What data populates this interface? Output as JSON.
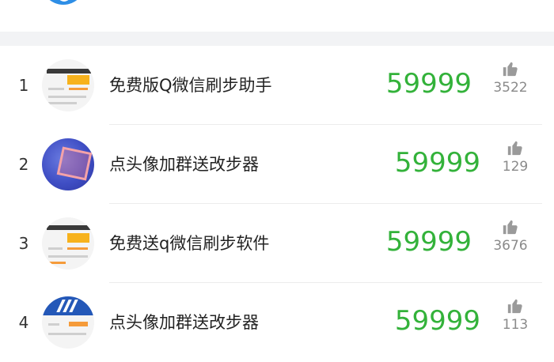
{
  "colors": {
    "steps": "#33b23a",
    "accent": "#2e8ee6",
    "likes": "#8a8a8a"
  },
  "icons": {
    "like": "thumbs-up-icon"
  },
  "rows": [
    {
      "rank": "1",
      "name": "免费版Q微信刷步助手",
      "steps": "59999",
      "likes": "3522",
      "avatar": "screenshot"
    },
    {
      "rank": "2",
      "name": "点头像加群送改步器",
      "steps": "59999",
      "likes": "129",
      "avatar": "basketball-hoop"
    },
    {
      "rank": "3",
      "name": "免费送q微信刷步软件",
      "steps": "59999",
      "likes": "3676",
      "avatar": "screenshot"
    },
    {
      "rank": "4",
      "name": "点头像加群送改步器",
      "steps": "59999",
      "likes": "113",
      "avatar": "shoe-screenshot"
    }
  ]
}
